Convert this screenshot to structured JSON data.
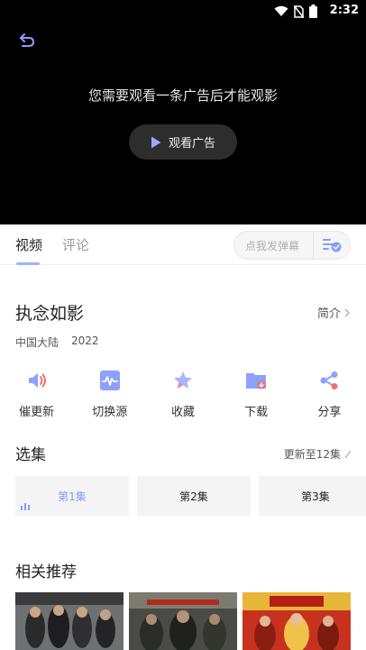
{
  "status": {
    "time": "2:32"
  },
  "player": {
    "ad_message": "您需要观看一条广告后才能观影",
    "ad_button": "观看广告"
  },
  "tabs": [
    {
      "label": "视频"
    },
    {
      "label": "评论"
    }
  ],
  "danmu": {
    "placeholder": "点我发弹幕"
  },
  "show": {
    "title": "执念如影",
    "intro_link": "简介",
    "region": "中国大陆",
    "year": "2022"
  },
  "actions": [
    {
      "label": "催更新",
      "icon": "speaker-icon"
    },
    {
      "label": "切换源",
      "icon": "waveform-icon"
    },
    {
      "label": "收藏",
      "icon": "star-icon"
    },
    {
      "label": "下载",
      "icon": "download-folder-icon"
    },
    {
      "label": "分享",
      "icon": "share-icon"
    }
  ],
  "episodes_section": {
    "title": "选集",
    "update_text": "更新至12集"
  },
  "episodes": [
    {
      "label": "第1集"
    },
    {
      "label": "第2集"
    },
    {
      "label": "第3集"
    }
  ],
  "recommend": {
    "title": "相关推荐"
  },
  "colors": {
    "accent": "#7f9dff",
    "player_bg": "#000000"
  }
}
